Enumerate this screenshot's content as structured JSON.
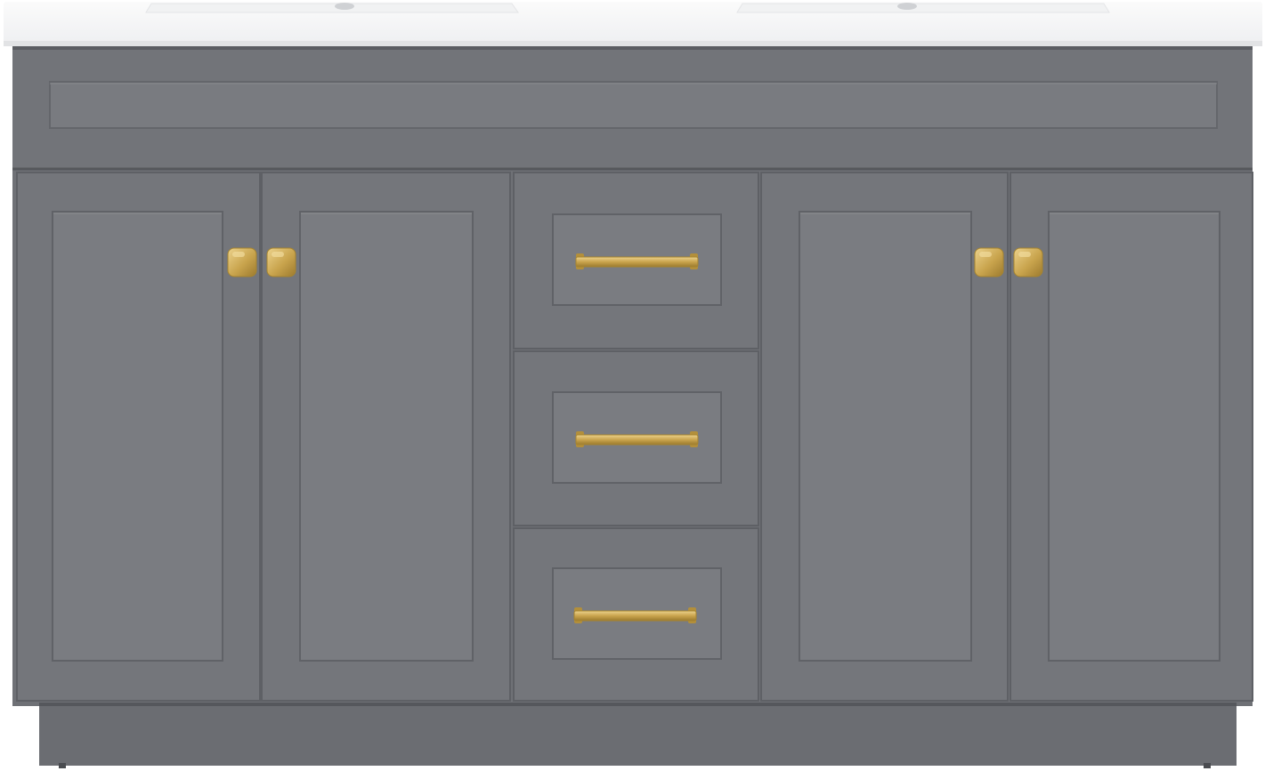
{
  "image": {
    "subject": "double-sink-bathroom-vanity",
    "colors": {
      "background": "#ffffff",
      "countertop": "#f7f7f7",
      "countertop_edge": "#e2e3e5",
      "cabinet": "#6f7176",
      "cabinet_light": "#7a7c81",
      "cabinet_dark": "#5b5d62",
      "panel": "#787a7f",
      "toe_kick": "#696b70",
      "hardware": "#c9a44d",
      "hardware_highlight": "#e8cd86",
      "hardware_shadow": "#9c7a2e"
    },
    "components": {
      "countertop": "white-double-sink-top",
      "false_drawer": "top-false-drawer-front",
      "doors": 4,
      "drawers": 3,
      "door_knobs": 4,
      "drawer_pulls": 3
    }
  }
}
